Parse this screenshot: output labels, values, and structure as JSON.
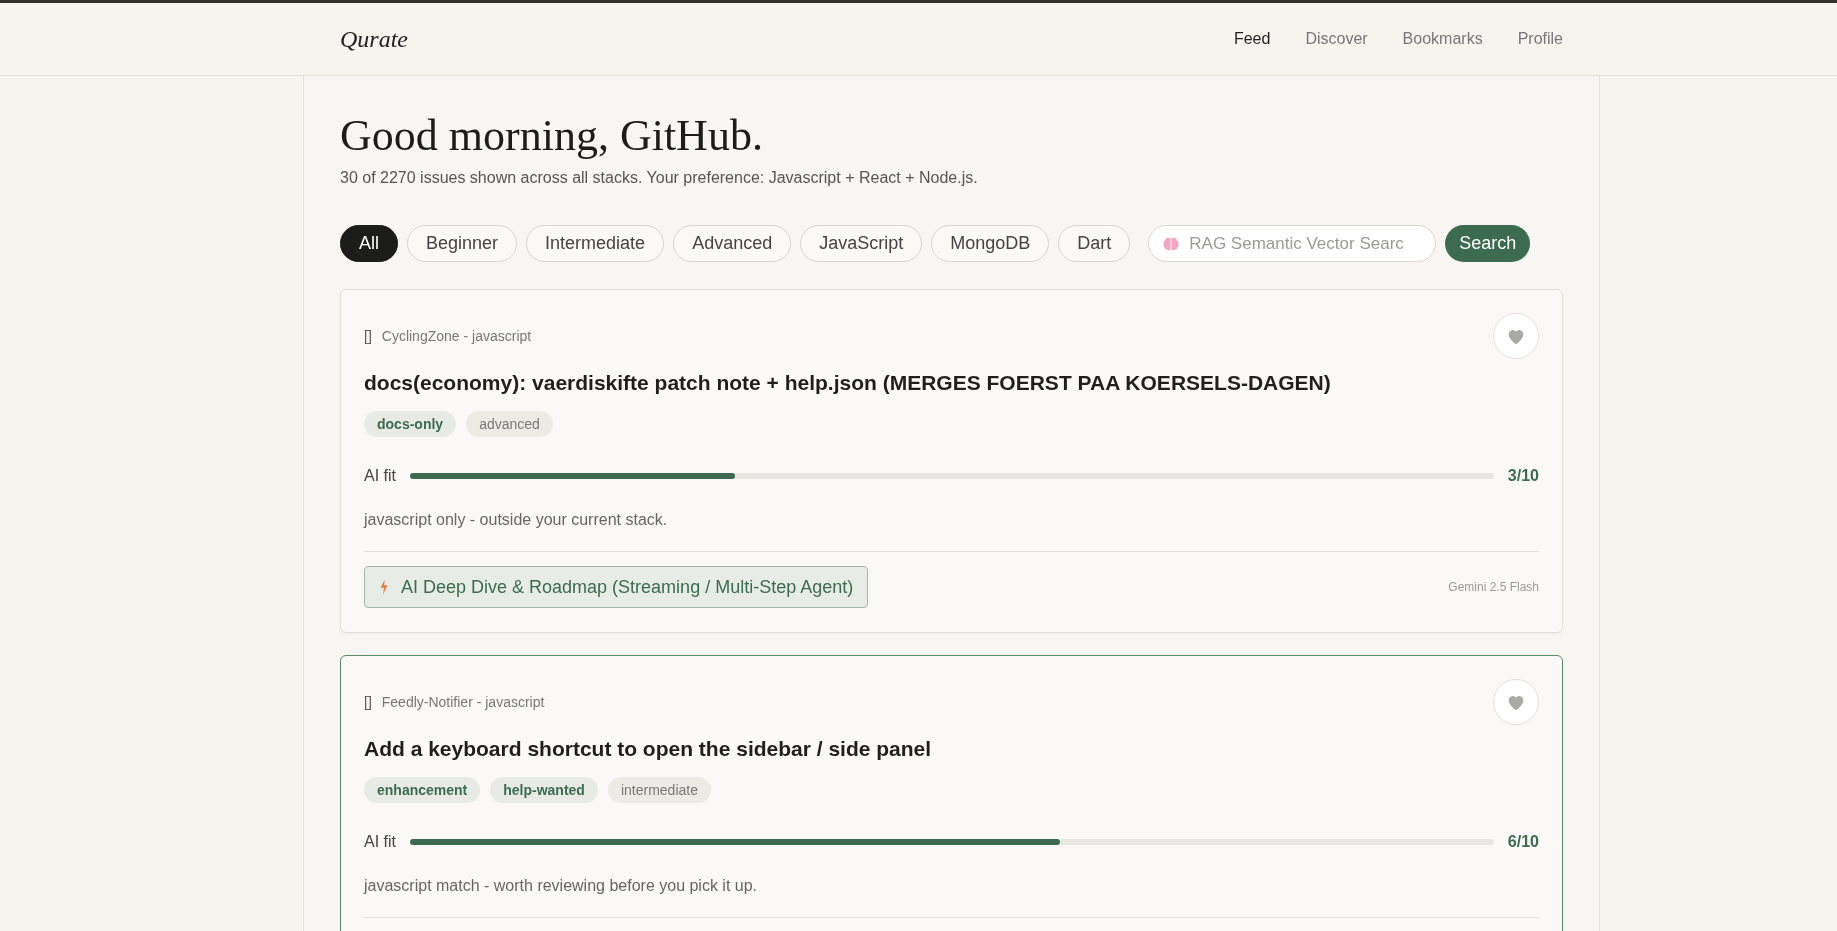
{
  "brand": "Qurate",
  "nav": [
    {
      "label": "Feed",
      "selected": true
    },
    {
      "label": "Discover",
      "selected": false
    },
    {
      "label": "Bookmarks",
      "selected": false
    },
    {
      "label": "Profile",
      "selected": false
    }
  ],
  "greeting": "Good morning, GitHub.",
  "summary": "30 of 2270 issues shown across all stacks. Your preference: Javascript + React + Node.js.",
  "filters": [
    {
      "label": "All",
      "selected": true
    },
    {
      "label": "Beginner",
      "selected": false
    },
    {
      "label": "Intermediate",
      "selected": false
    },
    {
      "label": "Advanced",
      "selected": false
    },
    {
      "label": "JavaScript",
      "selected": false
    },
    {
      "label": "MongoDB",
      "selected": false
    },
    {
      "label": "Dart",
      "selected": false
    }
  ],
  "search": {
    "placeholder": "RAG Semantic Vector Searc",
    "button": "Search"
  },
  "issues": [
    {
      "highlighted": false,
      "repo_icon": "[]",
      "repo": "CyclingZone - javascript",
      "title": "docs(economy): vaerdiskifte patch note + help.json (MERGES FOERST PAA KOERSELS-DAGEN)",
      "tags": [
        {
          "label": "docs-only",
          "kind": "label"
        },
        {
          "label": "advanced",
          "kind": "difficulty"
        }
      ],
      "fit_label": "AI fit",
      "level": 0.3,
      "score": "3/10",
      "note": "javascript only - outside your current stack.",
      "action": "AI Deep Dive & Roadmap (Streaming / Multi-Step Agent)",
      "model": "Gemini 2.5 Flash"
    },
    {
      "highlighted": true,
      "repo_icon": "[]",
      "repo": "Feedly-Notifier - javascript",
      "title": "Add a keyboard shortcut to open the sidebar / side panel",
      "tags": [
        {
          "label": "enhancement",
          "kind": "label"
        },
        {
          "label": "help-wanted",
          "kind": "label"
        },
        {
          "label": "intermediate",
          "kind": "difficulty"
        }
      ],
      "fit_label": "AI fit",
      "level": 0.6,
      "score": "6/10",
      "note": "javascript match - worth reviewing before you pick it up."
    }
  ]
}
